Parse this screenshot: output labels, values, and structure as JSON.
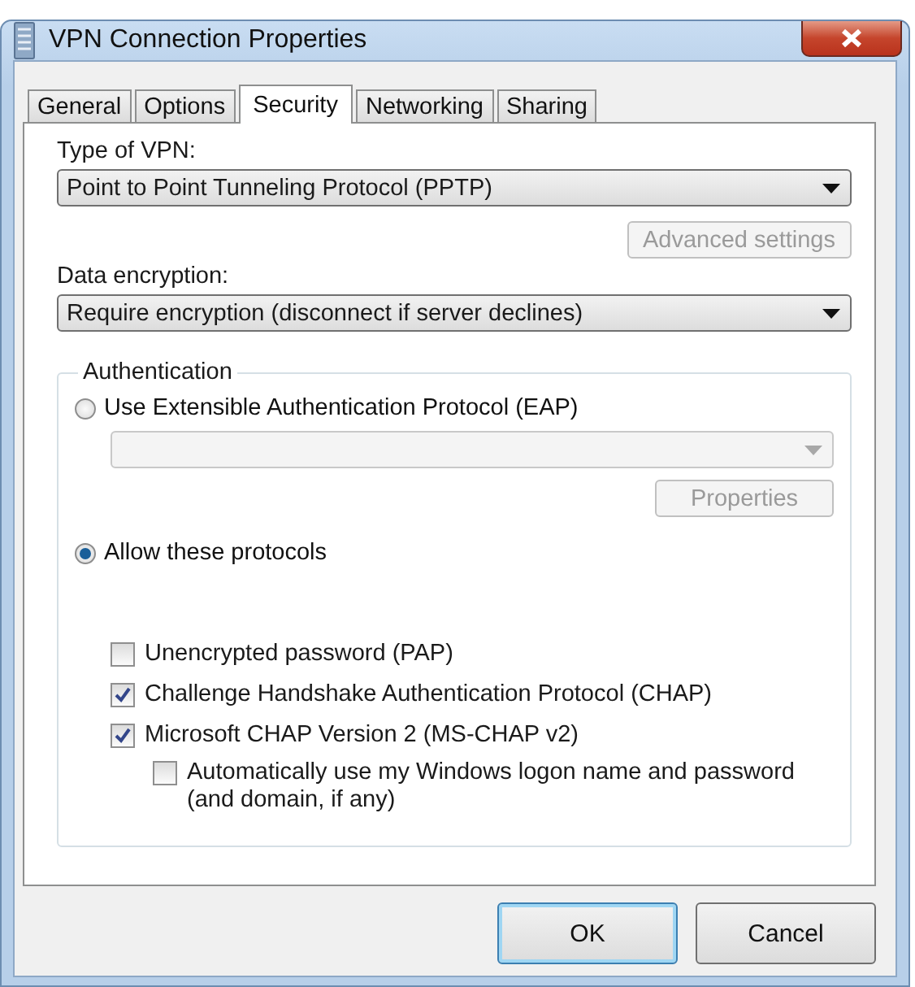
{
  "window": {
    "title": "VPN Connection Properties"
  },
  "tabs": [
    {
      "label": "General",
      "selected": false
    },
    {
      "label": "Options",
      "selected": false
    },
    {
      "label": "Security",
      "selected": true
    },
    {
      "label": "Networking",
      "selected": false
    },
    {
      "label": "Sharing",
      "selected": false
    }
  ],
  "vpn_type": {
    "label": "Type of VPN:",
    "value": "Point to Point Tunneling Protocol (PPTP)"
  },
  "advanced_button": {
    "label": "Advanced settings",
    "disabled": true
  },
  "encryption": {
    "label": "Data encryption:",
    "value": "Require encryption (disconnect if server declines)"
  },
  "authentication": {
    "title": "Authentication",
    "eap_option": {
      "label": "Use Extensible Authentication Protocol (EAP)",
      "selected": false
    },
    "eap_dropdown": {
      "disabled": true
    },
    "properties_button": {
      "label": "Properties",
      "disabled": true
    },
    "protocols_option": {
      "label": "Allow these protocols",
      "selected": true
    },
    "protocols": [
      {
        "label": "Unencrypted password (PAP)",
        "checked": false
      },
      {
        "label": "Challenge Handshake Authentication Protocol (CHAP)",
        "checked": true
      },
      {
        "label": "Microsoft CHAP Version 2 (MS-CHAP v2)",
        "checked": true,
        "children": [
          {
            "label": "Automatically use my Windows logon name and password (and domain, if any)",
            "checked": false
          }
        ]
      }
    ]
  },
  "buttons": [
    {
      "label": "OK",
      "default": true
    },
    {
      "label": "Cancel",
      "default": false
    }
  ]
}
